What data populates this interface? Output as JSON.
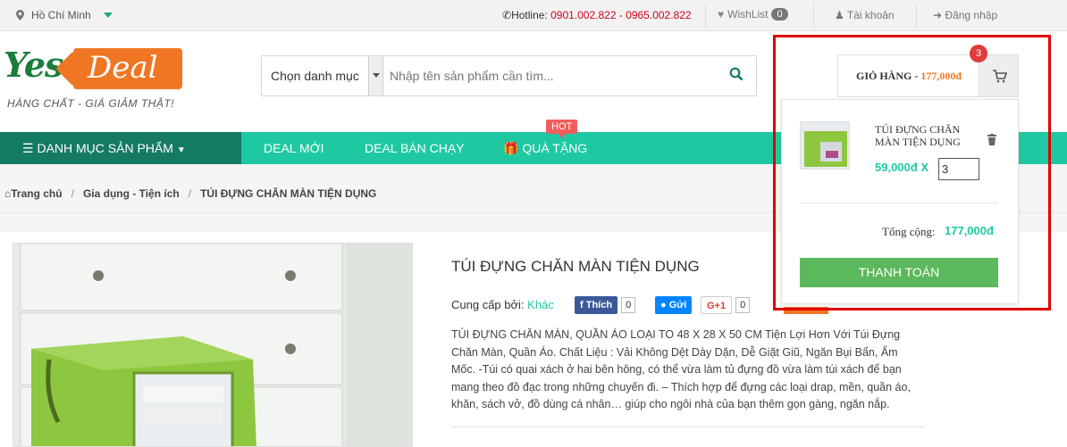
{
  "topbar": {
    "location": "Hồ Chí Minh",
    "hotline_label": "Hotline:",
    "hotline_numbers": "0901.002.822 - 0965.002.822",
    "wishlist_label": "WishList",
    "wishlist_count": "0",
    "account_label": "Tài khoản",
    "login_label": "Đăng nhập"
  },
  "logo": {
    "brand_left": "Yes",
    "brand_right": "Deal",
    "slogan": "HÀNG CHẤT - GIÁ GIẢM THẬT!"
  },
  "search": {
    "category_label": "Chọn danh mục",
    "placeholder": "Nhập tên sản phẩm cần tìm..."
  },
  "nav": {
    "menu_label": "DANH MỤC SẢN PHẨM",
    "items": [
      "DEAL MỚI",
      "DEAL BÁN CHẠY",
      "QUÀ TẶNG"
    ],
    "hot_badge": "HOT"
  },
  "breadcrumb": {
    "home": "Trang chủ",
    "category": "Gia dụng - Tiện ích",
    "current": "TÚI ĐỰNG CHĂN MÀN TIỆN DỤNG"
  },
  "product": {
    "title": "TÚI ĐỰNG CHĂN MÀN TIỆN DỤNG",
    "supplier_label": "Cung cấp bởi:",
    "supplier": "Khác",
    "like_label": "Thích",
    "like_count": "0",
    "send_label": "Gửi",
    "gplus_label": "G+1",
    "gplus_count": "0",
    "description": "TÚI ĐỰNG CHĂN MÀN, QUẦN ÁO LOẠI TO 48 X 28 X 50 CM Tiện Lợi Hơn Với Túi Đựng Chăn Màn, Quần Áo. Chất Liệu : Vải Không Dệt Dày Dặn, Dễ Giặt Giũ, Ngăn Bụi Bẩn, Ẩm Mốc. -Túi có quai xách ở hai bên hông, có thể vừa làm tủ đựng đồ vừa làm túi xách để bạn mang theo đồ đạc trong những chuyến đi. – Thích hợp để đựng các loại drap, mền, quần áo, khăn, sách vở, đồ dùng cá nhân… giúp cho ngôi nhà của bạn thêm gọn gàng, ngăn nắp."
  },
  "cart": {
    "label": "GIỎ HÀNG -",
    "amount": "177,000đ",
    "count": "3",
    "item_name": "TÚI ĐỰNG CHĂN MÀN TIỆN DỤNG",
    "item_price": "59,000đ X",
    "item_qty": "3",
    "total_label": "Tổng cộng:",
    "total_value": "177,000đ",
    "checkout_label": "THANH TOÁN"
  },
  "colors": {
    "accent": "#1ec9a2",
    "nav_dark": "#147a63",
    "brand_orange": "#f07623",
    "hotline_red": "#d0021b",
    "highlight_red": "#e00000"
  }
}
